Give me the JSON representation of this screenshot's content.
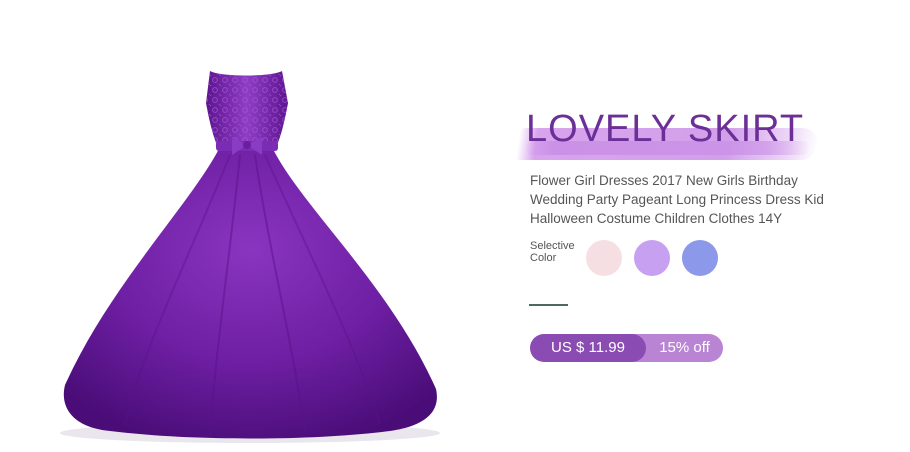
{
  "product": {
    "heading": "LOVELY SKIRT",
    "description": "Flower Girl Dresses 2017 New Girls Birthday Wedding Party Pageant Long Princess Dress Kid Halloween Costume Children Clothes 14Y",
    "image_alt": "purple lace princess dress"
  },
  "color_selector": {
    "label_line1": "Selective",
    "label_line2": "Color",
    "swatches": [
      {
        "name": "pink",
        "color": "#f6dfe3"
      },
      {
        "name": "lavender",
        "color": "#c8a0f2"
      },
      {
        "name": "periwinkle",
        "color": "#8c99ea"
      }
    ]
  },
  "price": {
    "amount": "US $ 11.99",
    "discount": "15% off"
  },
  "colors": {
    "accent": "#6b2f97",
    "pill_dark": "#8a4bb3",
    "pill_light": "#b984d4",
    "dress": "#6a1f9a"
  }
}
